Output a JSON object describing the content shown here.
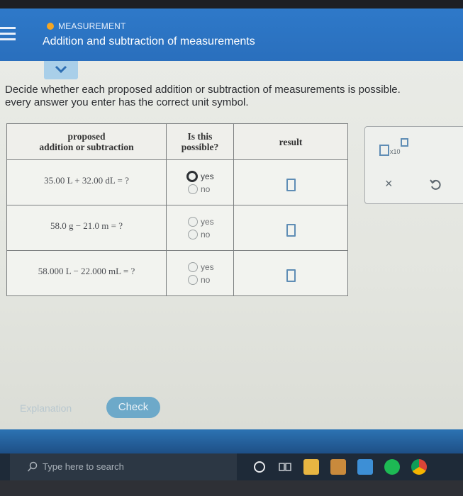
{
  "header": {
    "topic": "MEASUREMENT",
    "title": "Addition and subtraction of measurements"
  },
  "instruction": {
    "line1": "Decide whether each proposed addition or subtraction of measurements is possible.",
    "line2": "every answer you enter has the correct unit symbol."
  },
  "table": {
    "headers": {
      "col1_line1": "proposed",
      "col1_line2": "addition or subtraction",
      "col2_line1": "Is this",
      "col2_line2": "possible?",
      "col3": "result"
    },
    "rows": [
      {
        "expression": "35.00 L + 32.00 dL = ?",
        "yes": "yes",
        "no": "no"
      },
      {
        "expression": "58.0 g − 21.0 m = ?",
        "yes": "yes",
        "no": "no"
      },
      {
        "expression": "58.000 L − 22.000 mL = ?",
        "yes": "yes",
        "no": "no"
      }
    ]
  },
  "tools": {
    "exponent_label": "x10",
    "clear_icon": "×"
  },
  "buttons": {
    "explanation": "Explanation",
    "check": "Check"
  },
  "taskbar": {
    "search_placeholder": "Type here to search"
  },
  "colors": {
    "header": "#2e79c9",
    "accent": "#f5a623",
    "check_button": "#6da9c9"
  }
}
